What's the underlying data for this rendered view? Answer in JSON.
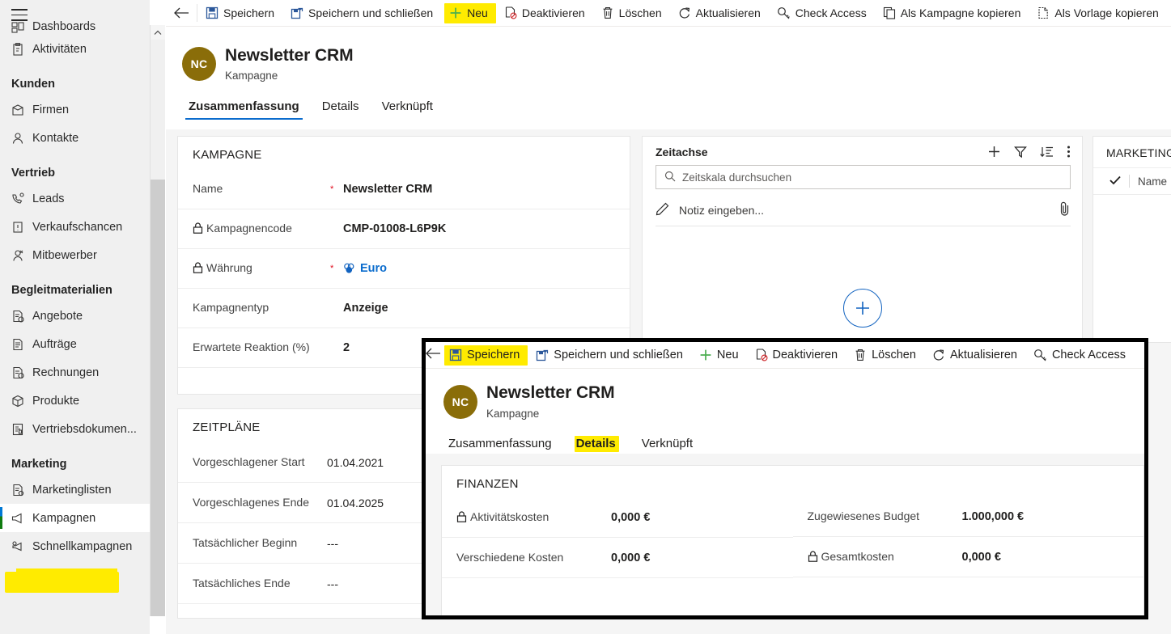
{
  "sidebar": {
    "items": [
      {
        "label": "Dashboards",
        "icon": "dashboard-icon",
        "type": "item",
        "clipped": true
      },
      {
        "label": "Aktivitäten",
        "icon": "activities-icon",
        "type": "item"
      },
      {
        "label": "Kunden",
        "type": "group"
      },
      {
        "label": "Firmen",
        "icon": "accounts-icon",
        "type": "item"
      },
      {
        "label": "Kontakte",
        "icon": "contacts-icon",
        "type": "item"
      },
      {
        "label": "Vertrieb",
        "type": "group"
      },
      {
        "label": "Leads",
        "icon": "leads-icon",
        "type": "item"
      },
      {
        "label": "Verkaufschancen",
        "icon": "opportunities-icon",
        "type": "item"
      },
      {
        "label": "Mitbewerber",
        "icon": "competitors-icon",
        "type": "item"
      },
      {
        "label": "Begleitmaterialien",
        "type": "group"
      },
      {
        "label": "Angebote",
        "icon": "quotes-icon",
        "type": "item"
      },
      {
        "label": "Aufträge",
        "icon": "orders-icon",
        "type": "item"
      },
      {
        "label": "Rechnungen",
        "icon": "invoices-icon",
        "type": "item"
      },
      {
        "label": "Produkte",
        "icon": "products-icon",
        "type": "item"
      },
      {
        "label": "Vertriebsdokumen...",
        "icon": "sales-documents-icon",
        "type": "item"
      },
      {
        "label": "Marketing",
        "type": "group"
      },
      {
        "label": "Marketinglisten",
        "icon": "marketing-lists-icon",
        "type": "item"
      },
      {
        "label": "Kampagnen",
        "icon": "campaigns-icon",
        "type": "item",
        "selected": true,
        "highlighted": true
      },
      {
        "label": "Schnellkampagnen",
        "icon": "quick-campaigns-icon",
        "type": "item"
      }
    ]
  },
  "commandbar": {
    "back_label": "Zurück",
    "items": [
      {
        "label": "Speichern",
        "icon": "save-icon"
      },
      {
        "label": "Speichern und schließen",
        "icon": "save-and-close-icon"
      },
      {
        "label": "Neu",
        "icon": "plus-icon",
        "highlighted": true
      },
      {
        "label": "Deaktivieren",
        "icon": "deactivate-icon"
      },
      {
        "label": "Löschen",
        "icon": "trash-icon"
      },
      {
        "label": "Aktualisieren",
        "icon": "refresh-icon"
      },
      {
        "label": "Check Access",
        "icon": "key-icon"
      },
      {
        "label": "Als Kampagne kopieren",
        "icon": "copy-icon"
      },
      {
        "label": "Als Vorlage kopieren",
        "icon": "template-icon"
      }
    ]
  },
  "record": {
    "initials": "NC",
    "title": "Newsletter CRM",
    "subtitle": "Kampagne",
    "tabs": [
      {
        "label": "Zusammenfassung",
        "active": true
      },
      {
        "label": "Details",
        "active": false
      },
      {
        "label": "Verknüpft",
        "active": false
      }
    ]
  },
  "kampagne_section": {
    "title": "KAMPAGNE",
    "rows": [
      {
        "label": "Name",
        "required": true,
        "locked": false,
        "value": "Newsletter CRM"
      },
      {
        "label": "Kampagnencode",
        "required": false,
        "locked": true,
        "value": "CMP-01008-L6P9K"
      },
      {
        "label": "Währung",
        "required": true,
        "locked": true,
        "value": "Euro",
        "is_link": true
      },
      {
        "label": "Kampagnentyp",
        "required": false,
        "locked": false,
        "value": "Anzeige"
      },
      {
        "label": "Erwartete Reaktion (%)",
        "required": false,
        "locked": false,
        "value": "2"
      }
    ]
  },
  "zeitplaene_section": {
    "title": "ZEITPLÄNE",
    "rows": [
      {
        "label": "Vorgeschlagener Start",
        "value": "01.04.2021"
      },
      {
        "label": "Vorgeschlagenes Ende",
        "value": "01.04.2025"
      },
      {
        "label": "Tatsächlicher Beginn",
        "value": "---"
      },
      {
        "label": "Tatsächliches Ende",
        "value": "---"
      }
    ]
  },
  "timeline": {
    "title": "Zeitachse",
    "actions": [
      {
        "name": "add-icon",
        "label": "Hinzufügen"
      },
      {
        "name": "filter-icon",
        "label": "Filtern"
      },
      {
        "name": "sort-icon",
        "label": "Sortieren"
      },
      {
        "name": "more-icon",
        "label": "Mehr Befehle"
      }
    ],
    "search_placeholder": "Zeitskala durchsuchen",
    "note_placeholder": "Notiz eingeben...",
    "attach_icon": "paperclip-icon",
    "add_record_label": "+"
  },
  "marketinglists_panel": {
    "title": "MARKETINGL",
    "column_header": "Name"
  },
  "popup": {
    "commandbar": {
      "items": [
        {
          "label": "Speichern",
          "icon": "save-icon",
          "highlighted": true
        },
        {
          "label": "Speichern und schließen",
          "icon": "save-and-close-icon"
        },
        {
          "label": "Neu",
          "icon": "plus-icon"
        },
        {
          "label": "Deaktivieren",
          "icon": "deactivate-icon"
        },
        {
          "label": "Löschen",
          "icon": "trash-icon"
        },
        {
          "label": "Aktualisieren",
          "icon": "refresh-icon"
        },
        {
          "label": "Check Access",
          "icon": "key-icon"
        }
      ]
    },
    "record": {
      "initials": "NC",
      "title": "Newsletter CRM",
      "subtitle": "Kampagne",
      "tabs": [
        {
          "label": "Zusammenfassung",
          "active": false
        },
        {
          "label": "Details",
          "active": true,
          "highlighted": true
        },
        {
          "label": "Verknüpft",
          "active": false
        }
      ]
    },
    "finanzen_section": {
      "title": "FINANZEN",
      "left_rows": [
        {
          "label": "Aktivitätskosten",
          "locked": true,
          "value": "0,000 €"
        },
        {
          "label": "Verschiedene Kosten",
          "locked": false,
          "value": "0,000 €"
        }
      ],
      "right_rows": [
        {
          "label": "Zugewiesenes Budget",
          "locked": false,
          "value": "1.000,000 €"
        },
        {
          "label": "Gesamtkosten",
          "locked": true,
          "value": "0,000 €"
        }
      ]
    }
  },
  "colors": {
    "accent": "#0b6ccd",
    "highlight": "#ffeb00",
    "avatar": "#8a6d09",
    "required": "#e00b1c",
    "sidebar_bg": "#f0f0f0"
  }
}
